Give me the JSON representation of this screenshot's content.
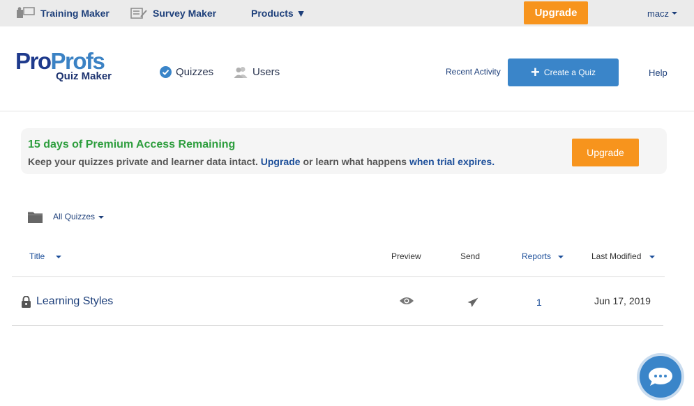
{
  "topbar": {
    "training_maker": "Training Maker",
    "survey_maker": "Survey Maker",
    "products": "Products ▼",
    "upgrade": "Upgrade",
    "user": "macz"
  },
  "header": {
    "logo_pro": "Pro",
    "logo_profs": "Profs",
    "logo_sub": "Quiz Maker",
    "nav_quizzes": "Quizzes",
    "nav_users": "Users",
    "recent_activity": "Recent Activity",
    "create_quiz": "Create a Quiz",
    "help": "Help"
  },
  "banner": {
    "title": "15 days of Premium Access Remaining",
    "text_1": "Keep your quizzes private and learner data intact. ",
    "link_upgrade": "Upgrade",
    "text_2": " or learn what happens ",
    "link_trial": "when trial expires.",
    "button": "Upgrade"
  },
  "filter": {
    "label": "All Quizzes"
  },
  "table": {
    "columns": {
      "title": "Title",
      "preview": "Preview",
      "send": "Send",
      "reports": "Reports",
      "last_modified": "Last Modified"
    },
    "rows": [
      {
        "title": "Learning Styles",
        "reports": "1",
        "last_modified": "Jun 17, 2019"
      }
    ]
  },
  "colors": {
    "accent_blue": "#3a85c9",
    "upgrade_orange": "#f7941d",
    "trial_green": "#2e9e3e"
  },
  "icons": [
    "training-maker-icon",
    "survey-maker-icon",
    "check-circle-icon",
    "users-icon",
    "plus-icon",
    "folder-icon",
    "lock-icon",
    "eye-icon",
    "paper-plane-icon",
    "chat-icon"
  ]
}
